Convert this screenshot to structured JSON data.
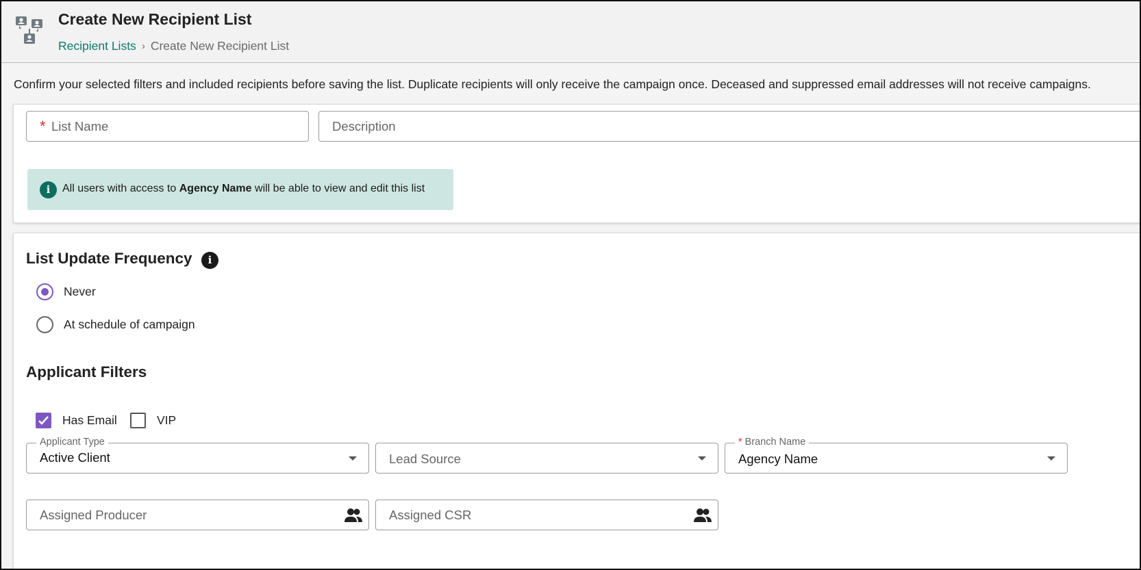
{
  "header": {
    "title": "Create New Recipient List",
    "breadcrumb": {
      "link": "Recipient Lists",
      "separator": "›",
      "current": "Create New Recipient List"
    }
  },
  "intro_text": "Confirm your selected filters and included recipients before saving the list. Duplicate recipients will only receive the campaign once. Deceased and suppressed email addresses will not receive campaigns.",
  "list_details": {
    "list_name": {
      "placeholder": "List Name",
      "value": "",
      "required": true
    },
    "description": {
      "placeholder": "Description",
      "value": ""
    },
    "notice": {
      "icon": "info-icon",
      "before": "All users with access to ",
      "agency": "Agency Name",
      "after": " will be able to view and edit this list"
    }
  },
  "update_frequency": {
    "title": "List Update Frequency",
    "info_icon": "info-icon",
    "options": [
      {
        "label": "Never",
        "selected": true
      },
      {
        "label": "At schedule of campaign",
        "selected": false
      }
    ]
  },
  "applicant_filters": {
    "title": "Applicant Filters",
    "checkboxes": [
      {
        "label": "Has Email",
        "checked": true
      },
      {
        "label": "VIP",
        "checked": false
      }
    ],
    "applicant_type": {
      "label": "Applicant Type",
      "value": "Active Client"
    },
    "lead_source": {
      "placeholder": "Lead Source",
      "value": ""
    },
    "branch_name": {
      "label": "Branch Name",
      "value": "Agency Name",
      "required": true
    },
    "assigned_producer": {
      "placeholder": "Assigned Producer",
      "icon": "people-icon"
    },
    "assigned_csr": {
      "placeholder": "Assigned CSR",
      "icon": "people-icon"
    }
  },
  "colors": {
    "accent": "#7e57c2",
    "link": "#0b7a6b",
    "notice_bg": "#cde6e1",
    "required": "#d32f2f"
  }
}
